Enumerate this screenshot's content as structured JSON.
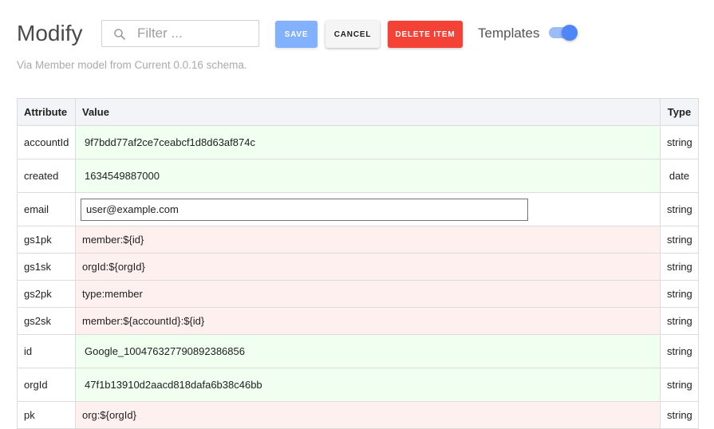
{
  "header": {
    "title": "Modify",
    "filter_placeholder": "Filter ...",
    "filter_value": "",
    "save_label": "SAVE",
    "cancel_label": "CANCEL",
    "delete_label": "DELETE ITEM",
    "templates_label": "Templates",
    "templates_enabled": true
  },
  "subtitle": "Via Member model from Current 0.0.16 schema.",
  "table": {
    "columns": [
      "Attribute",
      "Value",
      "Type"
    ],
    "rows": [
      {
        "attribute": "accountId",
        "value": "9f7bdd77af2ce7ceabcf1d8d63af874c",
        "type": "string",
        "status": "green"
      },
      {
        "attribute": "created",
        "value": "1634549887000",
        "type": "date",
        "status": "green"
      },
      {
        "attribute": "email",
        "value": "user@example.com",
        "type": "string",
        "status": "input"
      },
      {
        "attribute": "gs1pk",
        "value": "member:${id}",
        "type": "string",
        "status": "red"
      },
      {
        "attribute": "gs1sk",
        "value": "orgId:${orgId}",
        "type": "string",
        "status": "red"
      },
      {
        "attribute": "gs2pk",
        "value": "type:member",
        "type": "string",
        "status": "red"
      },
      {
        "attribute": "gs2sk",
        "value": "member:${accountId}:${id}",
        "type": "string",
        "status": "red"
      },
      {
        "attribute": "id",
        "value": "Google_100476327790892386856",
        "type": "string",
        "status": "green"
      },
      {
        "attribute": "orgId",
        "value": "47f1b13910d2aacd818dafa6b38c46bb",
        "type": "string",
        "status": "green"
      },
      {
        "attribute": "pk",
        "value": "org:${orgId}",
        "type": "string",
        "status": "red"
      }
    ]
  },
  "colors": {
    "save": "#82b1ff",
    "delete": "#f44336",
    "toggle": "#4f86f7",
    "row_green": "#f0fff0",
    "row_red": "#fff0f0"
  }
}
